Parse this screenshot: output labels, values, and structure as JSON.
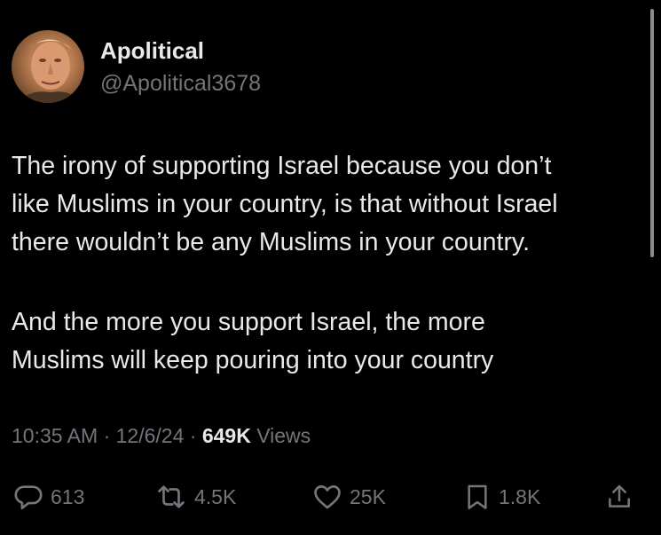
{
  "user": {
    "display_name": "Apolitical",
    "handle": "@Apolitical3678"
  },
  "tweet": {
    "paragraphs": [
      [
        "The irony of supporting Israel because you don’t",
        "like Muslims in your country, is that without Israel",
        "there wouldn’t be any Muslims in your country."
      ],
      [
        "And the more you support Israel, the more",
        "Muslims will keep pouring into your country"
      ]
    ],
    "time": "10:35 AM",
    "separator": " · ",
    "date": "12/6/24",
    "views_count": "649K",
    "views_label": " Views"
  },
  "actions": {
    "reply": {
      "icon": "reply-icon",
      "count": "613"
    },
    "repost": {
      "icon": "repost-icon",
      "count": "4.5K"
    },
    "like": {
      "icon": "heart-icon",
      "count": "25K"
    },
    "bookmark": {
      "icon": "bookmark-icon",
      "count": "1.8K"
    },
    "share": {
      "icon": "share-icon"
    }
  },
  "colors": {
    "background": "#000000",
    "primary_text": "#e7e9ea",
    "secondary_text": "#71767b"
  }
}
